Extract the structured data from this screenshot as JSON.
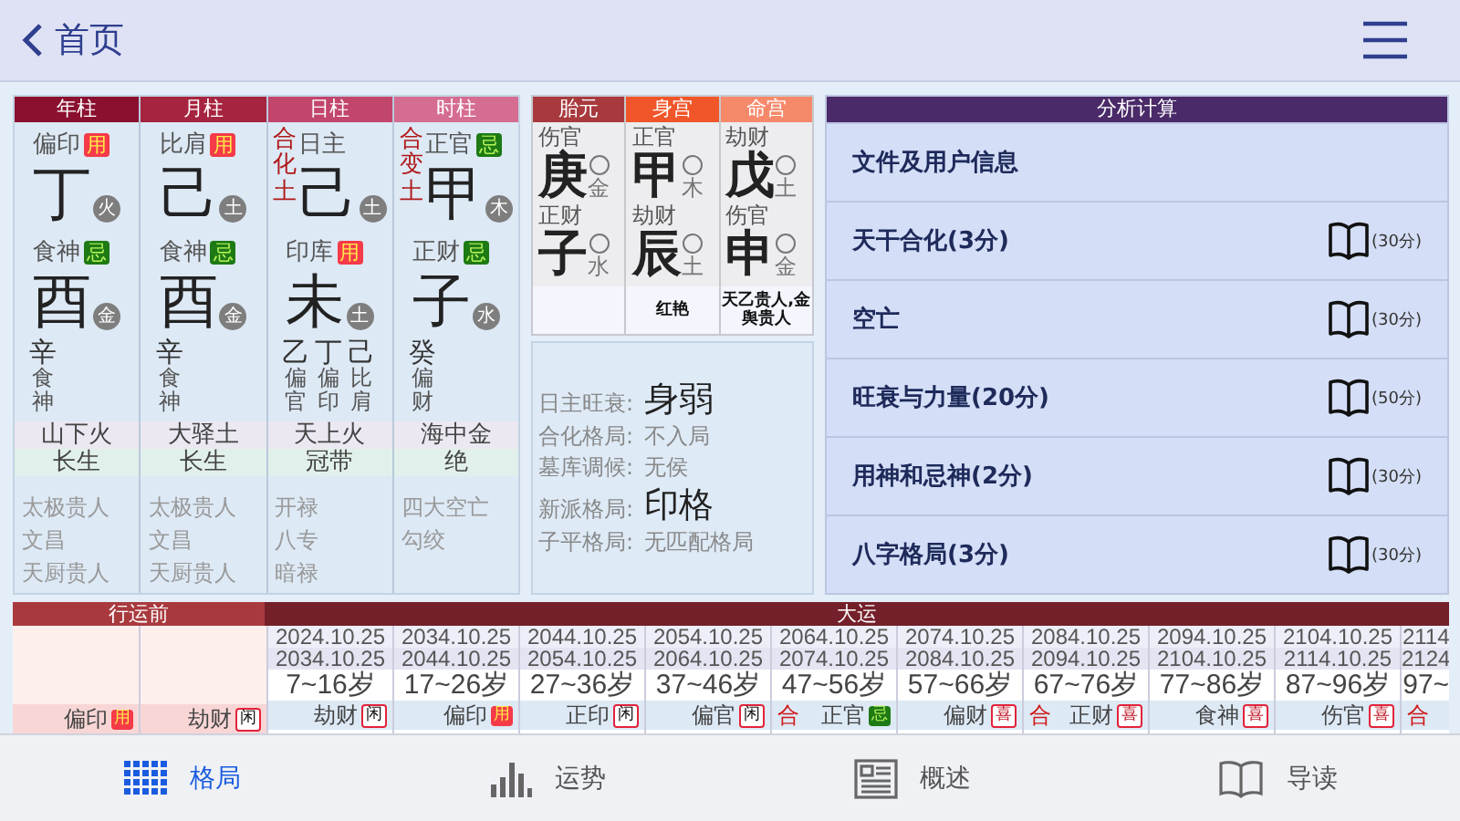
{
  "header": {
    "back_label": "首页"
  },
  "pillars": [
    {
      "title": "年柱",
      "color": "#8b1030",
      "stem": {
        "god": "偏印",
        "badge": {
          "text": "用",
          "kind": "yong"
        },
        "char": "丁",
        "element": "火"
      },
      "branch": {
        "god": "食神",
        "badge": {
          "text": "忌",
          "kind": "ji"
        },
        "char": "酉",
        "element": "金"
      },
      "hidden": [
        {
          "stem": "辛",
          "god": "食神"
        }
      ],
      "nayin": "山下火",
      "state": "长生",
      "shensha": [
        "太极贵人",
        "文昌",
        "天厨贵人"
      ]
    },
    {
      "title": "月柱",
      "color": "#a6243f",
      "stem": {
        "god": "比肩",
        "badge": {
          "text": "用",
          "kind": "yong"
        },
        "char": "己",
        "element": "土"
      },
      "branch": {
        "god": "食神",
        "badge": {
          "text": "忌",
          "kind": "ji"
        },
        "char": "酉",
        "element": "金"
      },
      "hidden": [
        {
          "stem": "辛",
          "god": "食神"
        }
      ],
      "nayin": "大驿土",
      "state": "长生",
      "shensha": [
        "太极贵人",
        "文昌",
        "天厨贵人"
      ]
    },
    {
      "title": "日柱",
      "color": "#c2456c",
      "stem": {
        "side_text": "合化土",
        "god": "日主",
        "char": "己",
        "element": "土"
      },
      "branch": {
        "god": "印库",
        "badge": {
          "text": "用",
          "kind": "yong"
        },
        "char": "未",
        "element": "土"
      },
      "hidden": [
        {
          "stem": "乙",
          "god": "偏官"
        },
        {
          "stem": "丁",
          "god": "偏印"
        },
        {
          "stem": "己",
          "god": "比肩"
        }
      ],
      "nayin": "天上火",
      "state": "冠带",
      "shensha": [
        "开禄",
        "八专",
        "暗禄"
      ]
    },
    {
      "title": "时柱",
      "color": "#d56c91",
      "stem": {
        "side_text": "合变土",
        "god": "正官",
        "badge": {
          "text": "忌",
          "kind": "ji"
        },
        "char": "甲",
        "element": "木"
      },
      "branch": {
        "god": "正财",
        "badge": {
          "text": "忌",
          "kind": "ji"
        },
        "char": "子",
        "element": "水"
      },
      "hidden": [
        {
          "stem": "癸",
          "god": "偏财"
        }
      ],
      "nayin": "海中金",
      "state": "绝",
      "shensha": [
        "四大空亡",
        "勾绞"
      ]
    }
  ],
  "palaces": [
    {
      "title": "胎元",
      "color": "#a83a3e",
      "stem": {
        "god": "伤官",
        "char": "庚",
        "element": "金"
      },
      "branch": {
        "god": "正财",
        "char": "子",
        "element": "水"
      }
    },
    {
      "title": "身宫",
      "color": "#f0562a",
      "stem": {
        "god": "正官",
        "char": "甲",
        "element": "木"
      },
      "branch": {
        "god": "劫财",
        "char": "辰",
        "element": "土"
      },
      "shensha": "红艳"
    },
    {
      "title": "命宫",
      "color": "#f6896a",
      "stem": {
        "god": "劫财",
        "char": "戊",
        "element": "土"
      },
      "branch": {
        "god": "伤官",
        "char": "申",
        "element": "金"
      },
      "shensha": "天乙贵人,金舆贵人"
    }
  ],
  "summary": [
    {
      "label": "日主旺衰:",
      "value": "身弱",
      "emphasis": true
    },
    {
      "label": "合化格局:",
      "value": "不入局",
      "emphasis": false
    },
    {
      "label": "墓库调候:",
      "value": "无侯",
      "emphasis": false
    },
    {
      "label": "新派格局:",
      "value": "印格",
      "emphasis": true
    },
    {
      "label": "子平格局:",
      "value": "无匹配格局",
      "emphasis": false
    }
  ],
  "analysis": {
    "title": "分析计算",
    "items": [
      {
        "label": "文件及用户信息"
      },
      {
        "label": "天干合化(3分)",
        "score": "(30分)"
      },
      {
        "label": "空亡",
        "score": "(30分)"
      },
      {
        "label": "旺衰与力量(20分)",
        "score": "(50分)"
      },
      {
        "label": "用神和忌神(2分)",
        "score": "(30分)"
      },
      {
        "label": "八字格局(3分)",
        "score": "(30分)"
      }
    ]
  },
  "dayun": {
    "pre_label": "行运前",
    "label": "大运",
    "pre": [
      {
        "god": "偏印",
        "badge": {
          "text": "用",
          "kind": "yong"
        }
      },
      {
        "god": "劫财",
        "badge": {
          "text": "闲",
          "kind": "xian"
        }
      }
    ],
    "periods": [
      {
        "start": "2024.10.25",
        "end": "2034.10.25",
        "age": "7~16岁",
        "god": "劫财",
        "badge": {
          "text": "闲",
          "kind": "xian"
        }
      },
      {
        "start": "2034.10.25",
        "end": "2044.10.25",
        "age": "17~26岁",
        "god": "偏印",
        "badge": {
          "text": "用",
          "kind": "yong"
        }
      },
      {
        "start": "2044.10.25",
        "end": "2054.10.25",
        "age": "27~36岁",
        "god": "正印",
        "badge": {
          "text": "闲",
          "kind": "xian"
        }
      },
      {
        "start": "2054.10.25",
        "end": "2064.10.25",
        "age": "37~46岁",
        "god": "偏官",
        "badge": {
          "text": "闲",
          "kind": "xian"
        }
      },
      {
        "start": "2064.10.25",
        "end": "2074.10.25",
        "age": "47~56岁",
        "prefix": "合",
        "god": "正官",
        "badge": {
          "text": "忌",
          "kind": "ji"
        }
      },
      {
        "start": "2074.10.25",
        "end": "2084.10.25",
        "age": "57~66岁",
        "god": "偏财",
        "badge": {
          "text": "喜",
          "kind": "xi"
        }
      },
      {
        "start": "2084.10.25",
        "end": "2094.10.25",
        "age": "67~76岁",
        "prefix": "合",
        "god": "正财",
        "badge": {
          "text": "喜",
          "kind": "xi"
        }
      },
      {
        "start": "2094.10.25",
        "end": "2104.10.25",
        "age": "77~86岁",
        "god": "食神",
        "badge": {
          "text": "喜",
          "kind": "xi"
        }
      },
      {
        "start": "2104.10.25",
        "end": "2114.10.25",
        "age": "87~96岁",
        "god": "伤官",
        "badge": {
          "text": "喜",
          "kind": "xi"
        }
      },
      {
        "start": "2114",
        "end": "2124",
        "age": "97~",
        "prefix": "合"
      }
    ]
  },
  "tabs": [
    {
      "label": "格局",
      "kind": "grid",
      "selected": true
    },
    {
      "label": "运势",
      "kind": "bars",
      "selected": false
    },
    {
      "label": "概述",
      "kind": "doc",
      "selected": false
    },
    {
      "label": "导读",
      "kind": "book",
      "selected": false
    }
  ]
}
